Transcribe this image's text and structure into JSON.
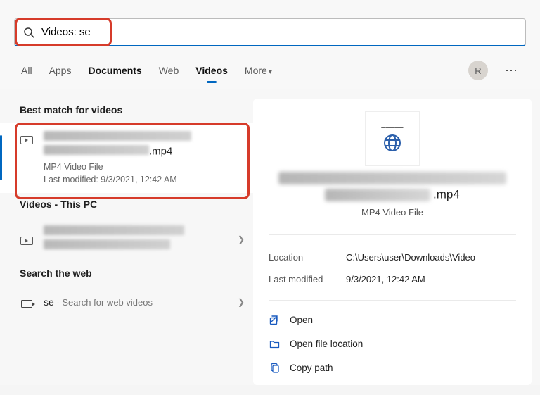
{
  "search": {
    "value": "Videos: se"
  },
  "tabs": {
    "items": [
      "All",
      "Apps",
      "Documents",
      "Web",
      "Videos",
      "More"
    ],
    "active_index": 4,
    "bold_index": 2
  },
  "user": {
    "initial": "R"
  },
  "left": {
    "best_match_header": "Best match for videos",
    "best": {
      "ext": ".mp4",
      "file_type": "MP4 Video File",
      "modified_label": "Last modified: 9/3/2021, 12:42 AM"
    },
    "videos_pc_header": "Videos - This PC",
    "search_web_header": "Search the web",
    "web": {
      "query": "se",
      "hint": " - Search for web videos"
    }
  },
  "preview": {
    "ext": ".mp4",
    "file_type": "MP4 Video File",
    "meta": {
      "location_label": "Location",
      "location_value": "C:\\Users\\user\\Downloads\\Video",
      "modified_label": "Last modified",
      "modified_value": "9/3/2021, 12:42 AM"
    },
    "actions": {
      "open": "Open",
      "open_loc": "Open file location",
      "copy_path": "Copy path"
    }
  }
}
